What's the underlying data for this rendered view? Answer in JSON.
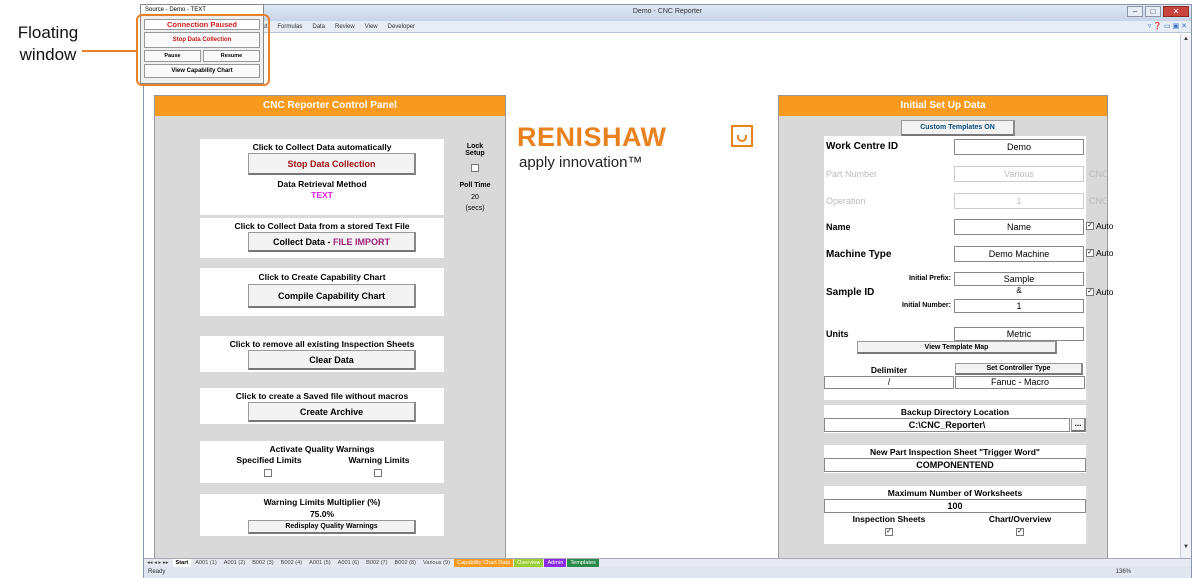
{
  "callout": {
    "line1": "Floating",
    "line2": "window"
  },
  "window": {
    "title": "Demo - CNC Reporter",
    "ribbon_tabs": [
      "yout",
      "Formulas",
      "Data",
      "Review",
      "View",
      "Developer"
    ],
    "sheet_tabs": [
      "Start",
      "A001 (1)",
      "A001 (2)",
      "B002 (3)",
      "B002 (4)",
      "A001 (5)",
      "A001 (6)",
      "B002 (7)",
      "B002 (8)",
      "Various (9)",
      "Capability Chart Data",
      "Overview",
      "Admin",
      "Templates"
    ],
    "status": "Ready",
    "zoom": "136%"
  },
  "floating": {
    "title": "Source - Demo - TEXT",
    "status": "Connection Paused",
    "stop": "Stop Data Collection",
    "pause": "Pause",
    "resume": "Resume",
    "view_chart": "View Capability Chart"
  },
  "control_panel": {
    "title": "CNC Reporter Control Panel",
    "collect_auto": "Click to Collect Data automatically",
    "stop_btn": "Stop Data Collection",
    "method_label": "Data Retrieval Method",
    "method_value": "TEXT",
    "lock_setup": "Lock\nSetup",
    "poll_time": "Poll Time",
    "poll_value": "20",
    "poll_unit": "(secs)",
    "collect_file": "Click to Collect Data from a stored Text File",
    "collect_btn_a": "Collect Data - ",
    "collect_btn_b": "FILE IMPORT",
    "create_chart": "Click to Create Capability Chart",
    "compile_btn": "Compile Capability Chart",
    "remove_sheets": "Click to remove all existing Inspection Sheets",
    "clear_btn": "Clear Data",
    "saved_file": "Click to create a Saved file without macros",
    "archive_btn": "Create Archive",
    "quality_title": "Activate Quality Warnings",
    "specified": "Specified Limits",
    "warning": "Warning Limits",
    "multiplier_title": "Warning Limits Multiplier (%)",
    "multiplier_value": "75.0%",
    "redisplay_btn": "Redisplay Quality Warnings"
  },
  "logo": {
    "brand": "RENISHAW",
    "tagline": "apply innovation™"
  },
  "setup": {
    "title": "Initial Set Up Data",
    "custom_btn": "Custom Templates ON",
    "work_centre_label": "Work Centre ID",
    "work_centre": "Demo",
    "part_label": "Part Number",
    "part": "Various",
    "cnc1": "CNC",
    "operation_label": "Operation",
    "operation": "1",
    "cnc2": "CNC",
    "name_label": "Name",
    "name": "Name",
    "auto": "Auto",
    "machine_label": "Machine Type",
    "machine": "Demo Machine",
    "sample_label": "Sample ID",
    "prefix_label": "Initial Prefix:",
    "prefix": "Sample",
    "amp": "&",
    "number_label": "Initial Number:",
    "number": "1",
    "units_label": "Units",
    "units": "Metric",
    "template_map_btn": "View Template Map",
    "delimiter_label": "Delimiter",
    "delimiter": "/",
    "controller_btn": "Set Controller Type",
    "controller": "Fanuc - Macro",
    "backup_label": "Backup Directory Location",
    "backup": "C:\\CNC_Reporter\\",
    "browse": "...",
    "trigger_label": "New Part Inspection Sheet \"Trigger Word\"",
    "trigger": "COMPONENTEND",
    "max_label": "Maximum Number of Worksheets",
    "max": "100",
    "inspection_label": "Inspection Sheets",
    "chart_label": "Chart/Overview"
  }
}
